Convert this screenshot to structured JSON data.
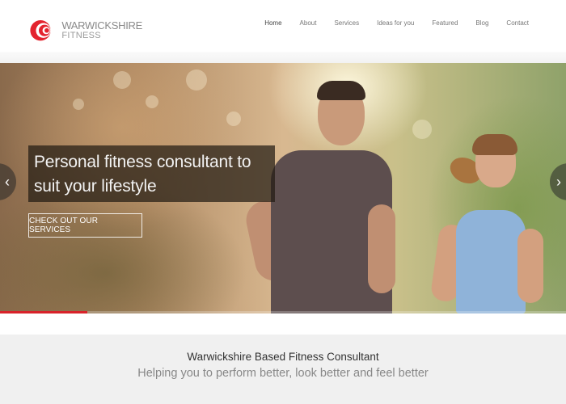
{
  "brand": {
    "line1": "WARWICKSHIRE",
    "line2": "FITNESS",
    "accent_color": "#e3232e"
  },
  "nav": {
    "items": [
      "Home",
      "About",
      "Services",
      "Ideas for you",
      "Featured",
      "Blog",
      "Contact"
    ],
    "active": "Home"
  },
  "hero": {
    "caption": "Personal fitness consultant to suit your lifestyle",
    "cta_label": "CHECK OUT OUR SERVICES",
    "prev_icon": "chevron-left-icon",
    "next_icon": "chevron-right-icon",
    "progress_color": "#d8232a"
  },
  "intro": {
    "title": "Warwickshire Based Fitness Consultant",
    "subtitle": "Helping you to perform better, look better and feel better"
  }
}
